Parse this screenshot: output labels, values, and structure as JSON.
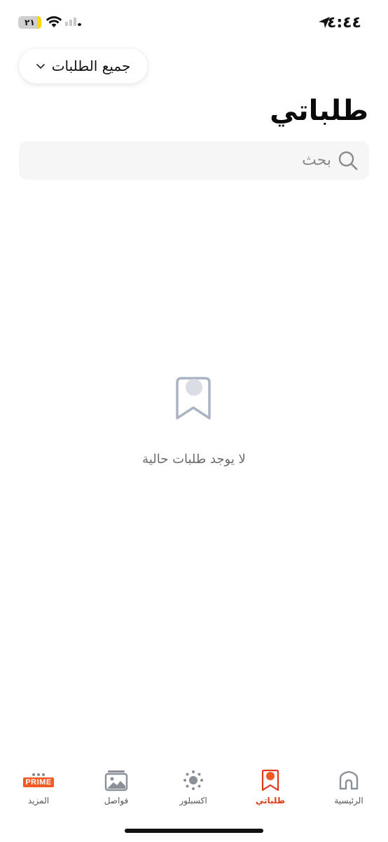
{
  "status_bar": {
    "time": "٤:٤٤",
    "battery_level": "٢١",
    "battery_color": "#ffd60a"
  },
  "filter": {
    "label": "جميع الطلبات",
    "chevron_icon": "chevron-down-icon"
  },
  "page": {
    "title": "طلباتي"
  },
  "search": {
    "placeholder": "بحث",
    "icon": "search-icon"
  },
  "empty_state": {
    "icon": "bookmark-icon",
    "message": "لا يوجد طلبات حالية"
  },
  "tab_bar": {
    "accent_color": "#e03a1c",
    "tabs": [
      {
        "label": "الرئيسية",
        "icon": "home-icon",
        "active": false
      },
      {
        "label": "طلباتي",
        "icon": "orders-icon",
        "active": true
      },
      {
        "label": "اكسبلور",
        "icon": "explore-icon",
        "active": false
      },
      {
        "label": "فواصل",
        "icon": "gallery-icon",
        "active": false
      },
      {
        "label": "المزيد",
        "icon": "prime-icon",
        "badge": "PRIME",
        "active": false
      }
    ]
  }
}
